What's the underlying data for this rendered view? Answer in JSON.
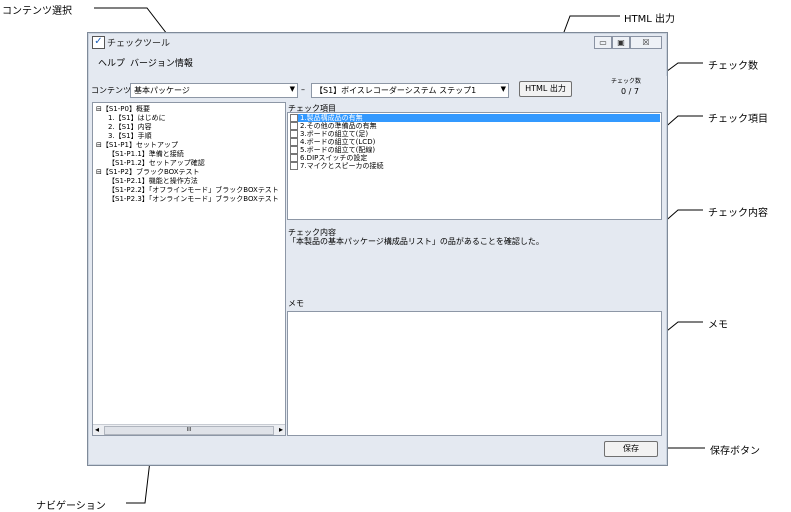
{
  "callouts": {
    "content_select": "コンテンツ選択",
    "html_output": "HTML 出力",
    "check_count": "チェック数",
    "check_items": "チェック項目",
    "check_content": "チェック内容",
    "memo": "メモ",
    "save_button": "保存ボタン",
    "navigation": "ナビゲーション"
  },
  "window": {
    "title": "チェックツール",
    "controls": {
      "minimize": "▭",
      "maximize": "▣",
      "close": "☒"
    }
  },
  "menu": [
    "ヘルプ",
    "バージョン情報"
  ],
  "toolbar": {
    "content_label": "コンテンツ",
    "content_value": "基本パッケージ",
    "dash": "–",
    "step_value": "【S1】ボイスレコーダーシステム ステップ1",
    "html_button": "HTML 出力",
    "count_label": "チェック数",
    "count_value": "0 / 7"
  },
  "tree": [
    {
      "text": "⊟【S1-P0】概要",
      "indent": 0
    },
    {
      "text": "1.【S1】はじめに",
      "indent": 2
    },
    {
      "text": "2.【S1】内容",
      "indent": 2
    },
    {
      "text": "3.【S1】手順",
      "indent": 2
    },
    {
      "text": "⊟【S1-P1】セットアップ",
      "indent": 0
    },
    {
      "text": "【S1-P1.1】準備と接続",
      "indent": 2
    },
    {
      "text": "【S1-P1.2】セットアップ確認",
      "indent": 2
    },
    {
      "text": "⊟【S1-P2】ブラックBOXテスト",
      "indent": 0
    },
    {
      "text": "【S1-P2.1】機能と操作方法",
      "indent": 2
    },
    {
      "text": "【S1-P2.2】「オフラインモード」ブラックBOXテスト",
      "indent": 2
    },
    {
      "text": "【S1-P2.3】「オンラインモード」ブラックBOXテスト",
      "indent": 2
    }
  ],
  "check_items": {
    "label": "チェック項目",
    "items": [
      {
        "text": "1.製品構成品の有無",
        "selected": true
      },
      {
        "text": "2.その他の準備品の有無",
        "selected": false
      },
      {
        "text": "3.ボードの組立て(足)",
        "selected": false
      },
      {
        "text": "4.ボードの組立て(LCD)",
        "selected": false
      },
      {
        "text": "5.ボードの組立て(配線)",
        "selected": false
      },
      {
        "text": "6.DIPスイッチの設定",
        "selected": false
      },
      {
        "text": "7.マイクとスピーカの接続",
        "selected": false
      }
    ]
  },
  "check_content": {
    "label": "チェック内容",
    "text": "「本製品の基本パッケージ構成品リスト」の品があることを確認した。"
  },
  "memo": {
    "label": "メモ",
    "text": ""
  },
  "scrollbar": {
    "left": "◂",
    "right": "▸",
    "thumb": "III"
  },
  "save_button": "保存"
}
